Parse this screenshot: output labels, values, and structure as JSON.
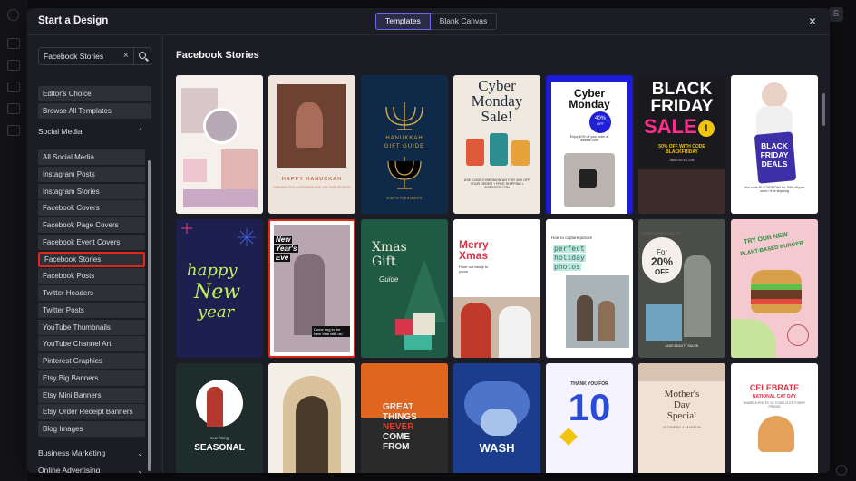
{
  "modal": {
    "title": "Start a Design",
    "tabs": [
      "Templates",
      "Blank Canvas"
    ],
    "close_icon": "×"
  },
  "search": {
    "value": "Facebook Stories",
    "clear_icon": "×"
  },
  "quick_links": [
    "Editor's Choice",
    "Browse All Templates"
  ],
  "sections": {
    "social_media": "Social Media",
    "business_marketing": "Business Marketing",
    "online_advertising": "Online Advertising"
  },
  "categories": [
    "All Social Media",
    "Instagram Posts",
    "Instagram Stories",
    "Facebook Covers",
    "Facebook Page Covers",
    "Facebook Event Covers",
    "Facebook Stories",
    "Facebook Posts",
    "Twitter Headers",
    "Twitter Posts",
    "YouTube Thumbnails",
    "YouTube Channel Art",
    "Pinterest Graphics",
    "Etsy Big Banners",
    "Etsy Mini Banners",
    "Etsy Order Receipt Banners",
    "Blog Images"
  ],
  "selected_category": "Facebook Stories",
  "main": {
    "title": "Facebook Stories"
  },
  "cards": {
    "hanukkah": {
      "main": "HAPPY HANUKKAH",
      "sub": "WISHING YOU BLESSINGS AND JOY THIS SEASON"
    },
    "gift_guide": {
      "l1": "HANUKKAH",
      "l2": "GIFT GUIDE",
      "sub": "8 GIFTS FOR 8 NIGHTS"
    },
    "cyber_sale": {
      "l1": "Cyber",
      "l2": "Monday",
      "l3": "Sale!",
      "sub": "USE CODE CYBERMONDAY FOR 30% OFF YOUR ORDER + FREE SHIPPING • AWESSITE.COM"
    },
    "cyber_blue": {
      "l1": "Cyber",
      "l2": "Monday",
      "badge": "40%",
      "badge_sub": "OFF",
      "sub": "Enjoy 40% off your order at awesite.com"
    },
    "black_friday": {
      "l1": "BLACK",
      "l2": "FRIDAY",
      "l3": "SALE",
      "sub": "50% OFF WITH CODE BLACKFRIDAY",
      "site": "AWESSITE.COM"
    },
    "bf_deals": {
      "l1": "BLACK",
      "l2": "FRIDAY",
      "l3": "DEALS",
      "sub": "Use code BLACKFRIDAY for 30% off your order / free shipping"
    },
    "new_year": {
      "l1": "happy",
      "l2": "New",
      "l3": "year"
    },
    "nye": {
      "l1": "New",
      "l2": "Year's",
      "l3": "Eve",
      "sub": "Come ring in the New Year with us!"
    },
    "xmas_gift": {
      "l1": "Xmas",
      "l2": "Gift",
      "l3": "Guide"
    },
    "merry_xmas": {
      "l1": "Merry",
      "l2": "Xmas",
      "sub": "From our family to yours"
    },
    "holiday_photos": {
      "top": "How to capture picture",
      "l1": "perfect",
      "l2": "holiday",
      "l3": "photos"
    },
    "off20": {
      "top": "REFER A FRIEND AND GET",
      "l1": "For",
      "l2": "20%",
      "l3": "OFF",
      "sub": "JADE BEAUTY SALON"
    },
    "burger": {
      "l1": "TRY OUR NEW",
      "l2": "PLANT-BASED BURGER"
    },
    "seasonal": {
      "top": "now hiring",
      "l1": "SEASONAL"
    },
    "great_things": {
      "l1": "GREAT",
      "l2": "THINGS",
      "l3": "NEVER",
      "l4": "COME",
      "l5": "FROM"
    },
    "wash": {
      "l1": "WASH"
    },
    "thank_you": {
      "top": "THANK YOU FOR",
      "num": "10"
    },
    "mothers_day": {
      "l1": "Mother's",
      "l2": "Day",
      "l3": "Special",
      "sub": "FLOWERS & MAKEUP"
    },
    "cat_day": {
      "l1": "CELEBRATE",
      "l2": "NATIONAL CAT DAY",
      "sub": "SHARE A PHOTO OF YOUR CUTE FURRY FRIEND"
    }
  },
  "colors": {
    "modal_bg": "#1c1c24",
    "accent": "#6c6ce0",
    "selection": "#e2261b"
  }
}
